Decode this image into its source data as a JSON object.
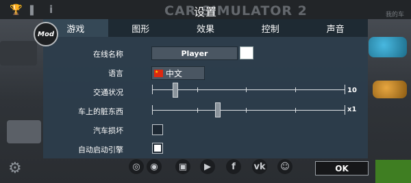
{
  "background": {
    "game_title": "CAR SIMULATOR 2",
    "my_car_label": "我的车",
    "icons": [
      "trophy-icon",
      "info-icon",
      "gear-icon",
      "instagram-icon",
      "twitch-icon",
      "youtube-icon",
      "facebook-icon",
      "vk-icon",
      "discord-icon"
    ]
  },
  "dialog": {
    "title": "设置",
    "mod_badge": "Mod",
    "tabs": [
      {
        "label": "游戏",
        "active": true
      },
      {
        "label": "图形",
        "active": false
      },
      {
        "label": "效果",
        "active": false
      },
      {
        "label": "控制",
        "active": false
      },
      {
        "label": "声音",
        "active": false
      }
    ],
    "settings": {
      "online_name": {
        "label": "在线名称",
        "value": "Player",
        "color": "#ffffff"
      },
      "language": {
        "label": "语言",
        "value": "中文",
        "flag": "china-flag-icon"
      },
      "traffic": {
        "label": "交通状况",
        "value_label": "10",
        "level": 0.12
      },
      "dirt": {
        "label": "车上的脏东西",
        "value_label": "x1",
        "level": 0.34
      },
      "car_damage": {
        "label": "汽车损坏",
        "checked": false
      },
      "auto_start": {
        "label": "自动启动引擎",
        "checked": true
      }
    },
    "ok_label": "OK"
  }
}
